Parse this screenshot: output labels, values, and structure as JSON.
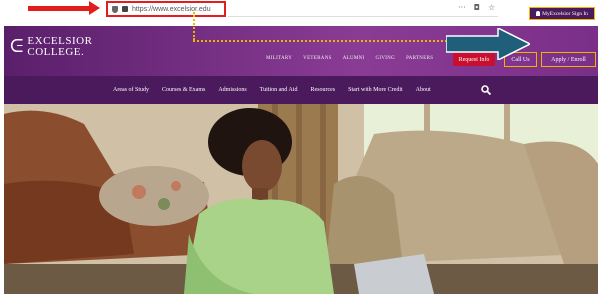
{
  "browser": {
    "url": "https://www.excelsior.edu",
    "icons": [
      "shield-icon",
      "lock-icon",
      "more-icon",
      "pocket-icon",
      "star-icon"
    ],
    "more_glyph": "···"
  },
  "brand": {
    "name_line1": "EXCELSIOR",
    "name_line2": "COLLEGE.",
    "colors": {
      "purple": "#5a1f6b",
      "dark_purple": "#4b1a5c",
      "gold": "#f2b200",
      "red": "#c8102e",
      "teal": "#1f5f7a"
    }
  },
  "header": {
    "top_links": [
      "MILITARY",
      "VETERANS",
      "ALUMNI",
      "GIVING",
      "PARTNERS"
    ],
    "request_info": "Request Info",
    "call_us": "Call Us",
    "apply_enroll": "Apply / Enroll",
    "sign_in": "MyExcelsior Sign In"
  },
  "nav": {
    "items": [
      "Areas of Study",
      "Courses & Exams",
      "Admissions",
      "Tuition and Aid",
      "Resources",
      "Start with More Credit",
      "About"
    ]
  }
}
